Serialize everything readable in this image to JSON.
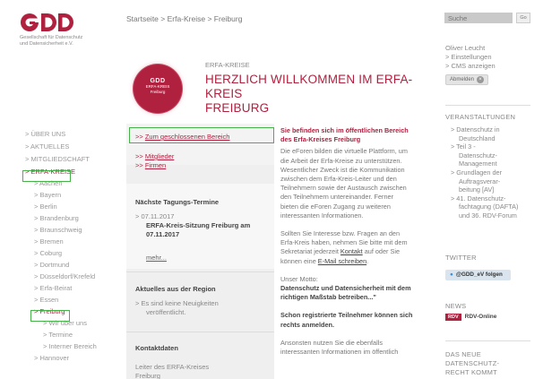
{
  "logo": {
    "text": "GDD",
    "subtitle_line1": "Gesellschaft für Datenschutz",
    "subtitle_line2": "und Datensicherheit e.V.",
    "color": "#b0203f"
  },
  "breadcrumb": "Startseite > Erfa-Kreise > Freiburg",
  "search": {
    "placeholder": "Suche",
    "button_label": "Go"
  },
  "user": {
    "name": "Oliver Leucht",
    "settings": "> Einstellungen",
    "cms": "> CMS anzeigen",
    "logout_label": "Abmelden"
  },
  "header": {
    "badge_gdd": "GDD",
    "badge_line1": "ERFA-KREIS",
    "badge_line2": "Freiburg",
    "kicker": "ERFA-KREISE",
    "title_line1": "HERZLICH WILLKOMMEN IM ERFA-KREIS",
    "title_line2": "FREIBURG"
  },
  "nav": [
    {
      "label": "> ÜBER UNS"
    },
    {
      "label": "> AKTUELLES"
    },
    {
      "label": "> MITGLIEDSCHAFT"
    },
    {
      "label": "> ERFA-KREISE"
    },
    {
      "label": "> Aachen"
    },
    {
      "label": "> Bayern"
    },
    {
      "label": "> Berlin"
    },
    {
      "label": "> Brandenburg"
    },
    {
      "label": "> Braunschweig"
    },
    {
      "label": "> Bremen"
    },
    {
      "label": "> Coburg"
    },
    {
      "label": "> Dortmund"
    },
    {
      "label": "> Düsseldorf/Krefeld"
    },
    {
      "label": "> Erfa-Beirat"
    },
    {
      "label": "> Essen"
    },
    {
      "label": "> Freiburg"
    },
    {
      "label": "> Wir über uns"
    },
    {
      "label": "> Termine"
    },
    {
      "label": "> Interner Bereich"
    },
    {
      "label": "> Hannover"
    }
  ],
  "middle": {
    "closed_area_prefix": ">> ",
    "closed_area_link": "Zum geschlossenen Bereich",
    "members_prefix": ">> ",
    "members_link": "Mitglieder",
    "firms_prefix": ">> ",
    "firms_link": "Firmen",
    "meetings_title": "Nächste Tagungs-Termine",
    "meeting_date": "> 07.11.2017",
    "meeting_title_line1": "ERFA-Kreis-Sitzung Freiburg am",
    "meeting_title_line2": "07.11.2017",
    "more": "mehr...",
    "news_title": "Aktuelles aus der Region",
    "news_text_line1": "> Es sind keine Neuigkeiten",
    "news_text_line2": "veröffentlicht.",
    "contact_title": "Kontaktdaten",
    "contact_text_line1": "Leiter des ERFA-Kreises",
    "contact_text_line2": "Freiburg"
  },
  "content": {
    "public_line1": "Sie befinden sich im öffentlichen Bereich",
    "public_line2": "des Erfa-Kreises Freiburg",
    "p1_lines": [
      "Die eForen bilden die virtuelle Plattform, um",
      "die Arbeit der Erfa-Kreise zu unterstützen.",
      "Wesentlicher Zweck ist die Kommunikation",
      "zwischen dem Erfa-Kreis-Leiter und den",
      "Teilnehmern sowie der Austausch zwischen",
      "den Teilnehmern untereinander. Ferner",
      "bieten die eForen Zugang zu weiteren",
      "interessanten Informationen."
    ],
    "p2_line1": "Sollten Sie Interesse bzw. Fragen an den",
    "p2_line2": "Erfa-Kreis haben, nehmen Sie bitte mit dem",
    "p2_line3_pre": "Sekretariat jederzeit ",
    "p2_contact_link": "Kontakt",
    "p2_line3_post": " auf oder Sie",
    "p2_line4_pre": "können eine ",
    "p2_email_link": "E-Mail schreiben",
    "p2_line4_post": ".",
    "motto_label": "Unser Motto:",
    "motto_line1": "Datenschutz und Datensicherheit mit dem",
    "motto_line2": "richtigen Maßstab betreiben...\"",
    "registered_line1": "Schon registrierte Teilnehmer können sich",
    "registered_line2": "rechts anmelden.",
    "more_line1": "Ansonsten nutzen Sie die ebenfalls",
    "more_line2": "interessanten Informationen im öffentlich"
  },
  "right": {
    "events_title": "VERANSTALTUNGEN",
    "events": [
      "> Datenschutz in",
      "Deutschland",
      "> Teil 3 -",
      "Datenschutz-",
      "Management",
      "> Grundlagen der",
      "Auftragsverar-",
      "beitung [AV]",
      "> 41. Datenschutz-",
      "fachtagung (DAFTA)",
      "und 36. RDV-Forum"
    ],
    "twitter_title": "TWITTER",
    "twitter_button": "@GDD_eV folgen",
    "news_title": "NEWS",
    "rdv_badge": "RDV",
    "rdv_label": "RDV-Online",
    "bottom_line1": "DAS NEUE",
    "bottom_line2": "DATENSCHUTZ-",
    "bottom_line3": "RECHT KOMMT"
  }
}
